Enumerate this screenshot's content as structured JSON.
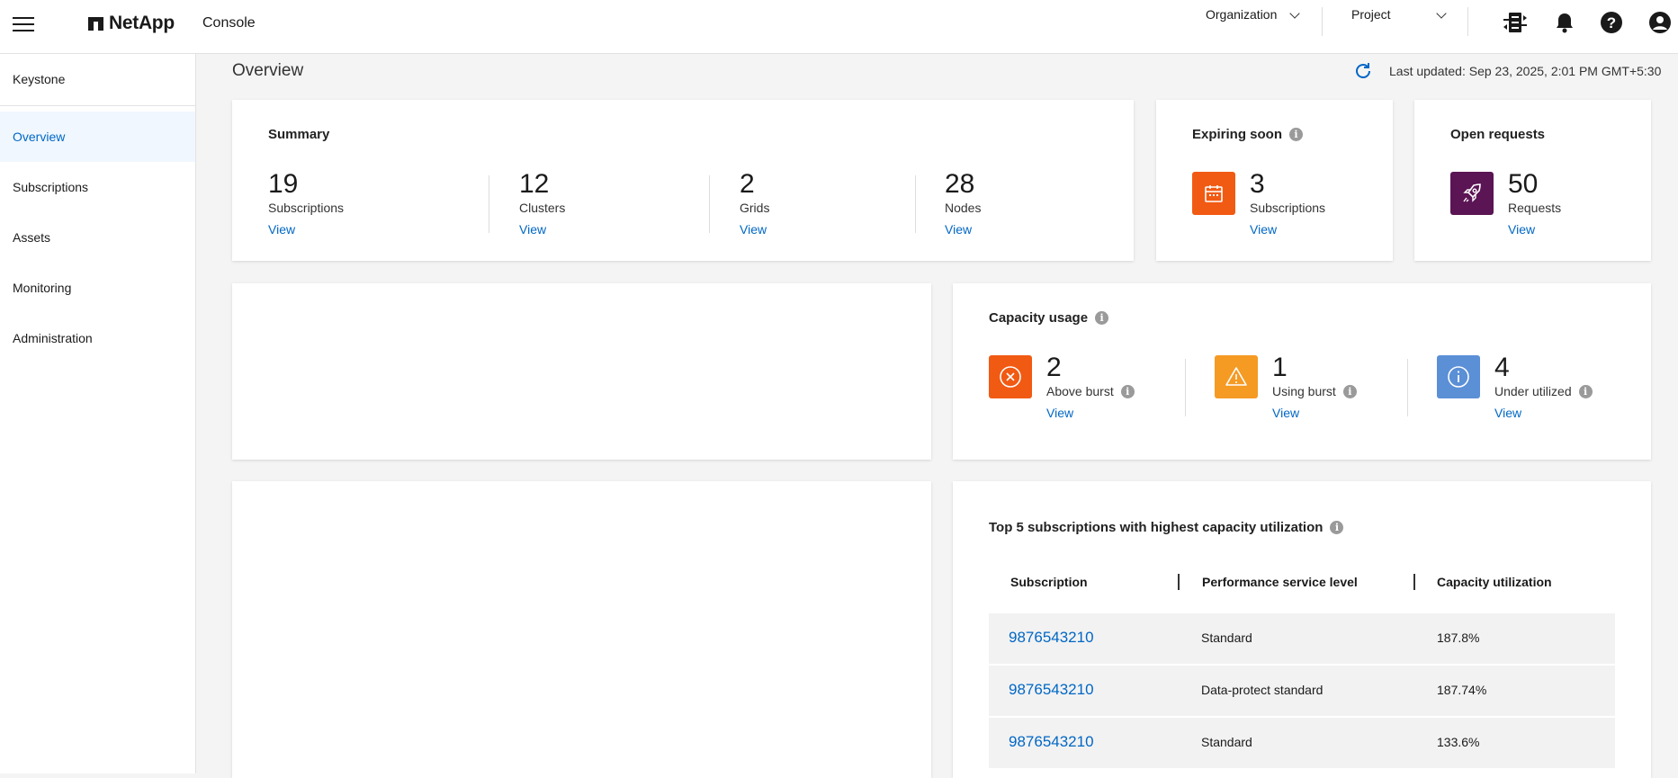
{
  "header": {
    "brand": "NetApp",
    "app_name": "Console",
    "organization_label": "Organization",
    "project_label": "Project",
    "icons": [
      "connector-icon",
      "bell-icon",
      "help-icon",
      "user-icon"
    ]
  },
  "sidebar": {
    "title": "Keystone",
    "items": [
      {
        "label": "Overview",
        "active": true
      },
      {
        "label": "Subscriptions"
      },
      {
        "label": "Assets"
      },
      {
        "label": "Monitoring"
      },
      {
        "label": "Administration"
      }
    ]
  },
  "page": {
    "title": "Overview",
    "last_updated": "Last updated: Sep 23, 2025, 2:01 PM GMT+5:30"
  },
  "summary": {
    "title": "Summary",
    "stats": [
      {
        "value": "19",
        "label": "Subscriptions",
        "link": "View"
      },
      {
        "value": "12",
        "label": "Clusters",
        "link": "View"
      },
      {
        "value": "2",
        "label": "Grids",
        "link": "View"
      },
      {
        "value": "28",
        "label": "Nodes",
        "link": "View"
      }
    ]
  },
  "expiring": {
    "title": "Expiring soon",
    "value": "3",
    "label": "Subscriptions",
    "link": "View",
    "color": "#f15a13"
  },
  "open_requests": {
    "title": "Open requests",
    "value": "50",
    "label": "Requests",
    "link": "View",
    "color": "#5b1454"
  },
  "capacity": {
    "title": "Capacity usage",
    "stats": [
      {
        "value": "2",
        "label": "Above burst",
        "link": "View",
        "color": "#f15a13",
        "icon": "circle-x-icon"
      },
      {
        "value": "1",
        "label": "Using burst",
        "link": "View",
        "color": "#f59a23",
        "icon": "warning-icon"
      },
      {
        "value": "4",
        "label": "Under utilized",
        "link": "View",
        "color": "#5b8fd6",
        "icon": "info-icon"
      }
    ]
  },
  "top5": {
    "title": "Top 5 subscriptions with highest capacity utilization",
    "columns": [
      "Subscription",
      "Performance service level",
      "Capacity utilization"
    ],
    "rows": [
      {
        "subscription": "9876543210",
        "level": "Standard",
        "utilization": "187.8%"
      },
      {
        "subscription": "9876543210",
        "level": "Data-protect standard",
        "utilization": "187.74%"
      },
      {
        "subscription": "9876543210",
        "level": "Standard",
        "utilization": "133.6%"
      }
    ]
  }
}
